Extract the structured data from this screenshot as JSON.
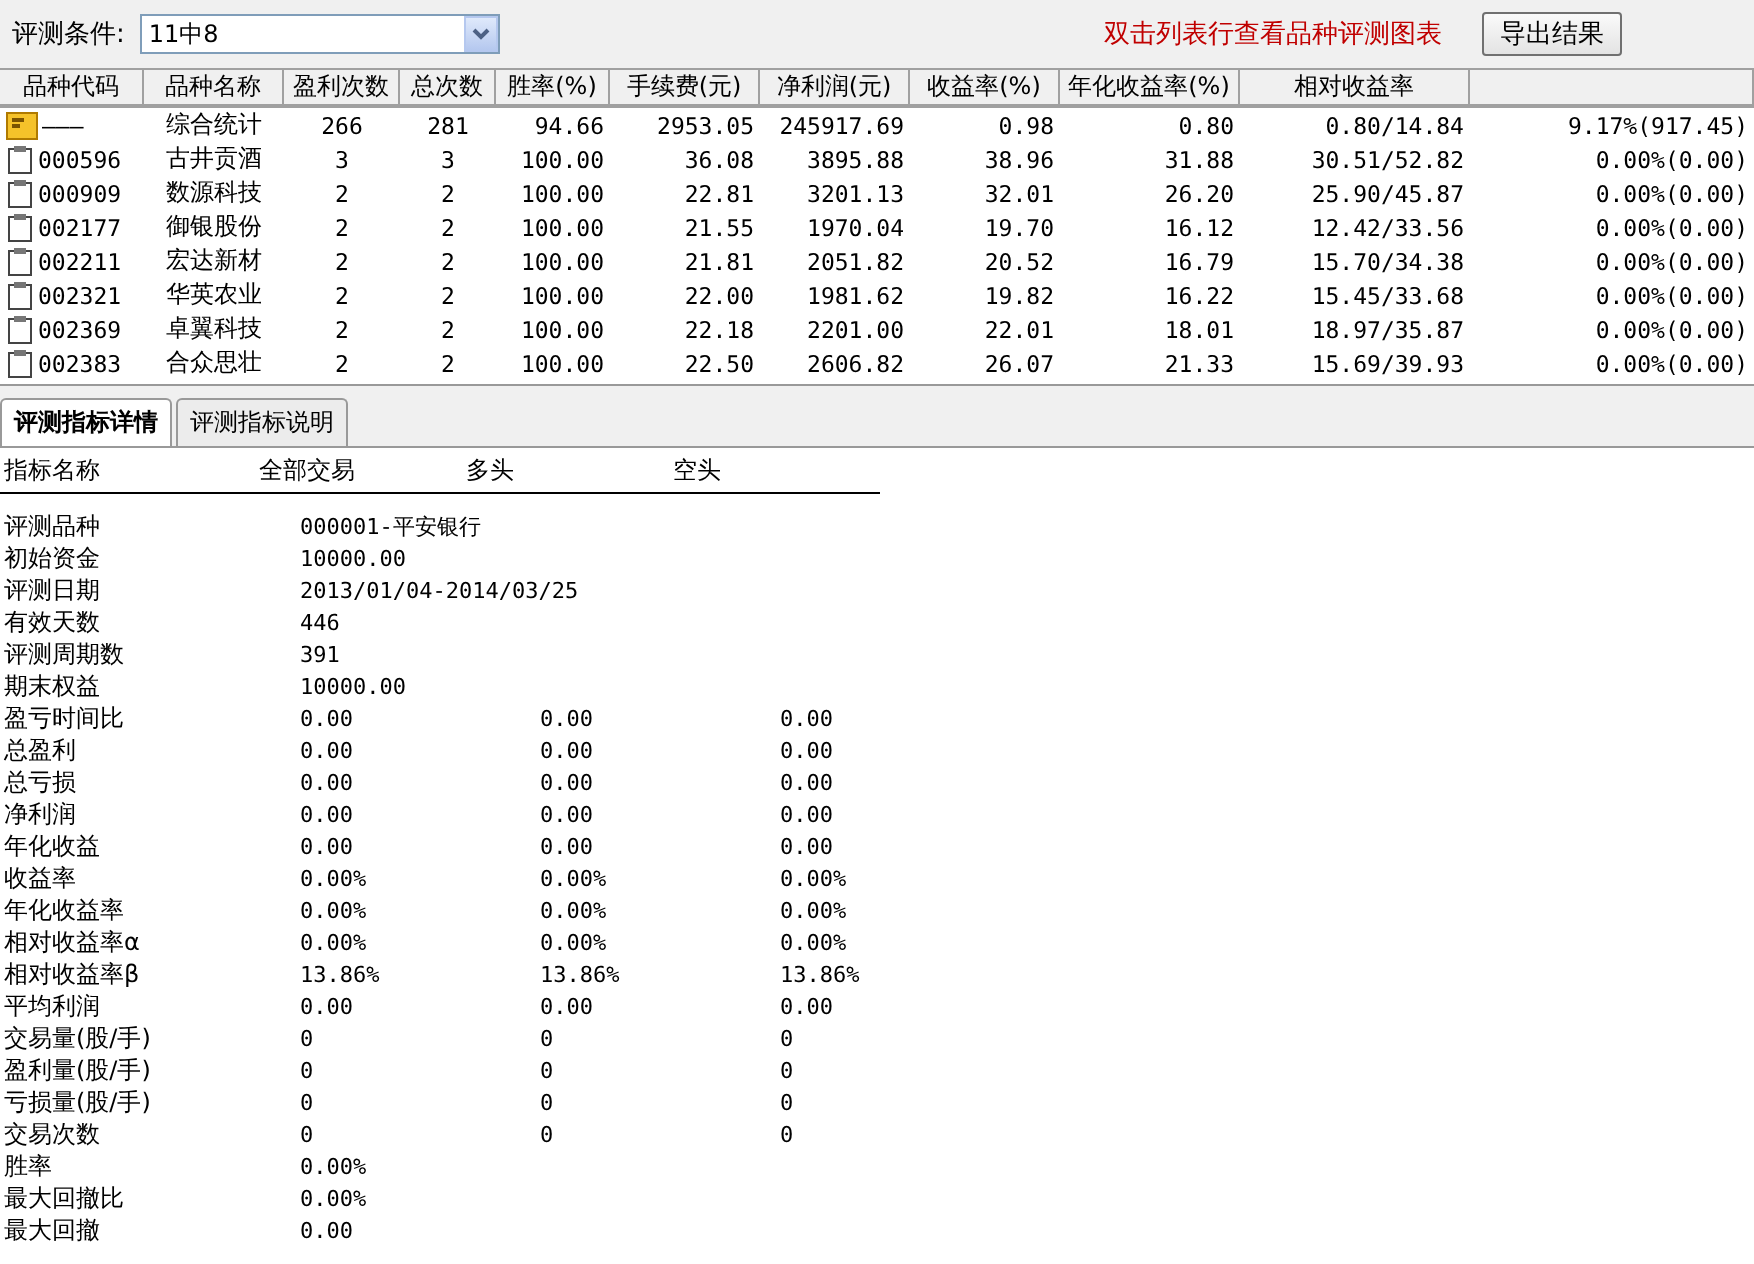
{
  "toolbar": {
    "condition_label": "评测条件:",
    "condition": {
      "value": "11中8"
    },
    "hint": "双击列表行查看品种评测图表",
    "export_button": "导出结果"
  },
  "table": {
    "columns": [
      "品种代码",
      "品种名称",
      "盈利次数",
      "总次数",
      "胜率(%)",
      "手续费(元)",
      "净利润(元)",
      "收益率(%)",
      "年化收益率(%)",
      "相对收益率",
      ""
    ],
    "rows": [
      {
        "kind": "summary",
        "cells": [
          "———",
          "综合统计",
          "266",
          "281",
          "94.66",
          "2953.05",
          "245917.69",
          "0.98",
          "0.80",
          "0.80/14.84",
          "9.17%(917.45)"
        ]
      },
      {
        "kind": "stock",
        "cells": [
          "000596",
          "古井贡酒",
          "3",
          "3",
          "100.00",
          "36.08",
          "3895.88",
          "38.96",
          "31.88",
          "30.51/52.82",
          "0.00%(0.00)"
        ]
      },
      {
        "kind": "stock",
        "cells": [
          "000909",
          "数源科技",
          "2",
          "2",
          "100.00",
          "22.81",
          "3201.13",
          "32.01",
          "26.20",
          "25.90/45.87",
          "0.00%(0.00)"
        ]
      },
      {
        "kind": "stock",
        "cells": [
          "002177",
          "御银股份",
          "2",
          "2",
          "100.00",
          "21.55",
          "1970.04",
          "19.70",
          "16.12",
          "12.42/33.56",
          "0.00%(0.00)"
        ]
      },
      {
        "kind": "stock",
        "cells": [
          "002211",
          "宏达新材",
          "2",
          "2",
          "100.00",
          "21.81",
          "2051.82",
          "20.52",
          "16.79",
          "15.70/34.38",
          "0.00%(0.00)"
        ]
      },
      {
        "kind": "stock",
        "cells": [
          "002321",
          "华英农业",
          "2",
          "2",
          "100.00",
          "22.00",
          "1981.62",
          "19.82",
          "16.22",
          "15.45/33.68",
          "0.00%(0.00)"
        ]
      },
      {
        "kind": "stock",
        "cells": [
          "002369",
          "卓翼科技",
          "2",
          "2",
          "100.00",
          "22.18",
          "2201.00",
          "22.01",
          "18.01",
          "18.97/35.87",
          "0.00%(0.00)"
        ]
      },
      {
        "kind": "stock",
        "cells": [
          "002383",
          "合众思壮",
          "2",
          "2",
          "100.00",
          "22.50",
          "2606.82",
          "26.07",
          "21.33",
          "15.69/39.93",
          "0.00%(0.00)"
        ]
      }
    ]
  },
  "tabs": [
    {
      "label": "评测指标详情",
      "selected": true
    },
    {
      "label": "评测指标说明",
      "selected": false
    }
  ],
  "details": {
    "columns": [
      "指标名称",
      "全部交易",
      "多头",
      "空头"
    ],
    "rows": [
      [
        "评测品种",
        "000001-平安银行"
      ],
      [
        "初始资金",
        "10000.00"
      ],
      [
        "评测日期",
        "2013/01/04-2014/03/25"
      ],
      [
        "有效天数",
        "446"
      ],
      [
        "评测周期数",
        "391"
      ],
      [
        "期末权益",
        "10000.00"
      ],
      [
        "盈亏时间比",
        "0.00",
        "0.00",
        "0.00"
      ],
      [
        "总盈利",
        "0.00",
        "0.00",
        "0.00"
      ],
      [
        "总亏损",
        "0.00",
        "0.00",
        "0.00"
      ],
      [
        "净利润",
        "0.00",
        "0.00",
        "0.00"
      ],
      [
        "年化收益",
        "0.00",
        "0.00",
        "0.00"
      ],
      [
        "收益率",
        "0.00%",
        "0.00%",
        "0.00%"
      ],
      [
        "年化收益率",
        "0.00%",
        "0.00%",
        "0.00%"
      ],
      [
        "相对收益率α",
        "0.00%",
        "0.00%",
        "0.00%"
      ],
      [
        "相对收益率β",
        "13.86%",
        "13.86%",
        "13.86%"
      ],
      [
        "平均利润",
        "0.00",
        "0.00",
        "0.00"
      ],
      [
        "交易量(股/手)",
        "0",
        "0",
        "0"
      ],
      [
        "盈利量(股/手)",
        "0",
        "0",
        "0"
      ],
      [
        "亏损量(股/手)",
        "0",
        "0",
        "0"
      ],
      [
        "交易次数",
        "0",
        "0",
        "0"
      ],
      [
        "胜率",
        "0.00%"
      ],
      [
        "最大回撤比",
        "0.00%"
      ],
      [
        "最大回撤",
        "0.00"
      ]
    ]
  }
}
